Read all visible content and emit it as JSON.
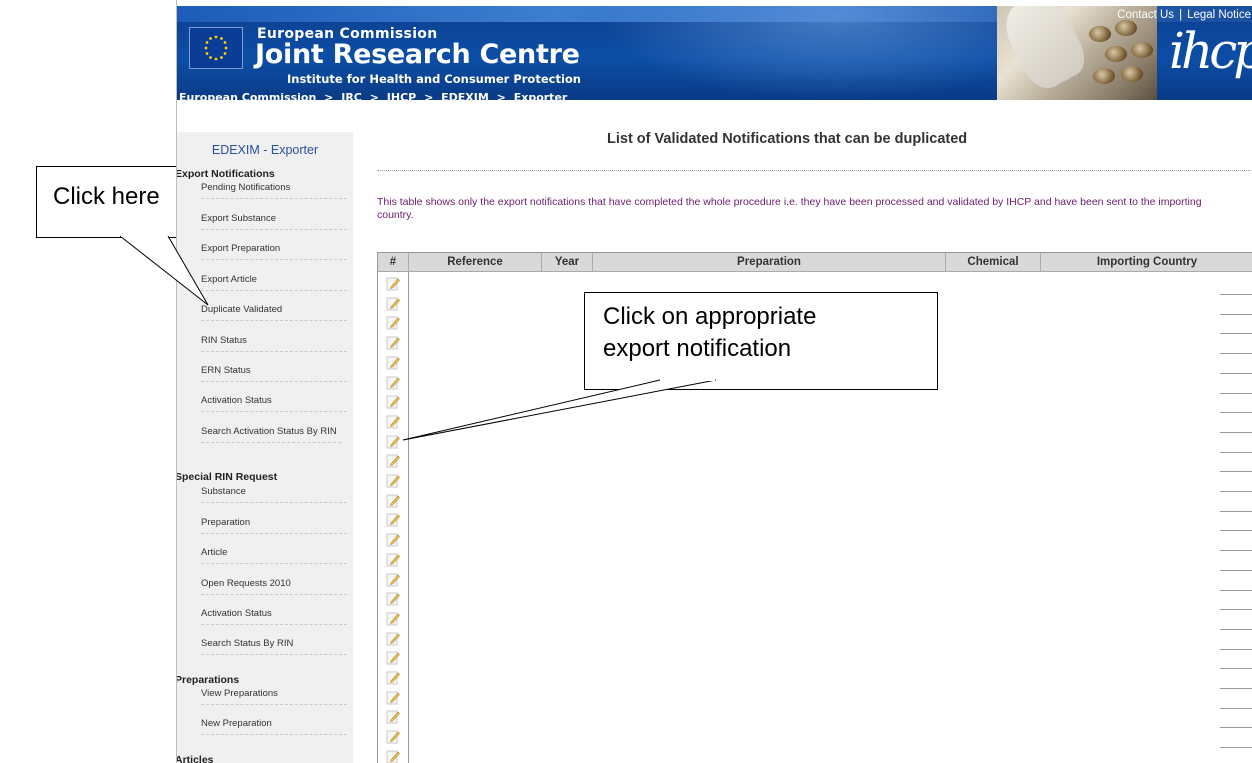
{
  "header": {
    "org_small": "European Commission",
    "org_large": "Joint Research Centre",
    "org_institute": "Institute for Health and Consumer Protection",
    "logo_text": "ihcp",
    "top_links": [
      "Contact Us",
      "Legal Notice"
    ],
    "breadcrumb": [
      "European Commission",
      ">",
      "JRC",
      ">",
      "IHCP",
      ">",
      "EDEXIM",
      ">",
      "Exporter"
    ]
  },
  "sidebar": {
    "title": "EDEXIM - Exporter",
    "sections": [
      {
        "label": "Export Notifications",
        "items": [
          "Pending Notifications",
          "Export Substance",
          "Export Preparation",
          "Export Article",
          "Duplicate Validated",
          "RIN Status",
          "ERN Status",
          "Activation Status",
          "Search Activation Status By RIN"
        ]
      },
      {
        "label": "Special RIN Request",
        "items": [
          "Substance",
          "Preparation",
          "Article",
          "Open Requests 2010",
          "Activation Status",
          "Search Status By RIN"
        ]
      },
      {
        "label": "Preparations",
        "items": [
          "View Preparations",
          "New Preparation"
        ]
      },
      {
        "label": "Articles",
        "items": []
      }
    ]
  },
  "main": {
    "title": "List of Validated Notifications that can be duplicated",
    "intro": "This table shows only the export notifications that have completed the whole procedure i.e. they have been processed and validated by IHCP and have been sent to the importing country.",
    "table": {
      "columns": [
        "#",
        "Reference",
        "Year",
        "Preparation",
        "Chemical",
        "Importing Country"
      ],
      "row_icon": "edit-icon",
      "row_count": 25
    }
  },
  "annotations": {
    "callout_1": "Click here",
    "callout_2_line1": "Click on appropriate",
    "callout_2_line2": "export notification"
  },
  "colors": {
    "banner": "#0c4ea6",
    "sidebar_bg": "#f0f0f0",
    "sidebar_title": "#2850a0",
    "intro_text": "#6a1d6a",
    "table_header_bg": "#d9d9d9"
  }
}
